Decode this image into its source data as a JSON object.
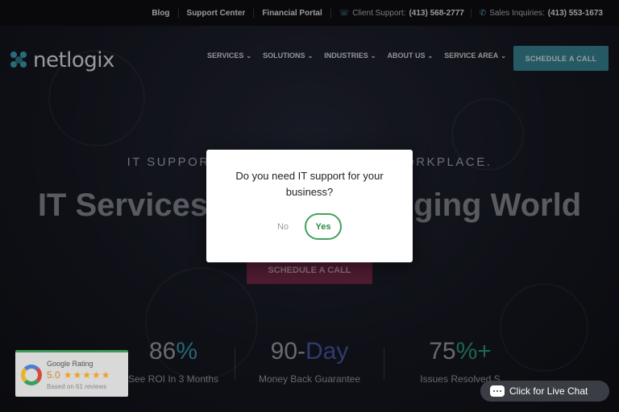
{
  "topbar": {
    "links": [
      "Blog",
      "Support Center",
      "Financial Portal"
    ],
    "client_label": "Client Support:",
    "client_phone": "(413) 568-2777",
    "sales_label": "Sales Inquiries:",
    "sales_phone": "(413) 553-1673"
  },
  "brand": {
    "name": "netlogix",
    "accent": "#3fa6bb"
  },
  "nav": {
    "items": [
      "SERVICES",
      "SOLUTIONS",
      "INDUSTRIES",
      "ABOUT US",
      "SERVICE AREA"
    ],
    "cta": "SCHEDULE A CALL"
  },
  "hero": {
    "eyebrow_left": "IT SUPPORT",
    "eyebrow_right": "ORKPLACE.",
    "headline_left": "IT Services",
    "headline_right": "ging World",
    "cta": "SCHEDULE A CALL"
  },
  "stats": [
    {
      "value": "86",
      "suffix": "%",
      "caption": "See ROI In 3 Months"
    },
    {
      "value": "90-",
      "suffix": "Day",
      "caption": "Money Back Guarantee"
    },
    {
      "value": "75",
      "suffix": "%+",
      "caption": "Issues Resolved S"
    }
  ],
  "modal": {
    "question": "Do you need IT support for your business?",
    "no_label": "No",
    "yes_label": "Yes"
  },
  "rating": {
    "title": "Google Rating",
    "score": "5.0",
    "stars": "★★★★★",
    "based_on": "Based on 61 reviews"
  },
  "chat": {
    "label": "Click for Live Chat"
  }
}
